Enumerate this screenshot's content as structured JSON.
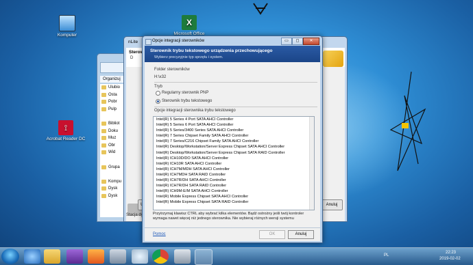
{
  "desktop": {
    "icons": [
      {
        "label": "Komputer",
        "icon": "computer-icon"
      },
      {
        "label": "Microsoft Office",
        "icon": "excel-icon"
      },
      {
        "label": "Acrobat Reader DC",
        "icon": "acrobat-icon"
      }
    ]
  },
  "explorer": {
    "menu": "Organizuj",
    "nav": [
      "Ulubio",
      "Osta",
      "Pobr",
      "Pulp",
      "",
      "Bibliot",
      "Doku",
      "Muz",
      "Obr",
      "Wid",
      "",
      "Grupa",
      "",
      "Kompu",
      "Dysk",
      "Dysk"
    ]
  },
  "nlite": {
    "title": "nLite",
    "head_title": "Sterow",
    "head_sub": "D",
    "status": "Stacja dysk",
    "buttons": [
      "Ul",
      "Anuluj"
    ]
  },
  "dialog": {
    "title": "Opcje integracji sterowników",
    "header_title": "Sterownik trybu tekstowego urządzenia przechowującego",
    "header_subtitle": "Wybierz precyzyjnie typ sprzętu i system.",
    "folder_label": "Folder sterowników",
    "folder_value": "H:\\x32",
    "mode_label": "Tryb",
    "radio_pnp": "Regularny sterownik PNP",
    "radio_text": "Sterownik trybu tekstowego",
    "options_label": "Opcje integracji sterownika trybu tekstowego",
    "drivers": [
      "Intel(R) 5 Series 4 Port SATA AHCI Controller",
      "Intel(R) 5 Series 6 Port SATA AHCI Controller",
      "Intel(R) 5 Series/3400 Series SATA AHCI Controller",
      "Intel(R) 7 Series Chipset Family SATA AHCI Controller",
      "Intel(R) 7 Series/C216 Chipset Family SATA AHCI Controller",
      "Intel(R) Desktop/Workstation/Server Express Chipset SATA AHCI Controller",
      "Intel(R) Desktop/Workstation/Server Express Chipset SATA RAID Controller",
      "Intel(R) ICH10D/DO SATA AHCI Controller",
      "Intel(R) ICH10R SATA AHCI Controller",
      "Intel(R) ICH7M/MDH SATA AHCI Controller",
      "Intel(R) ICH7MDH SATA RAID Controller",
      "Intel(R) ICH7R/DH SATA AHCI Controller",
      "Intel(R) ICH7R/DH SATA RAID Controller",
      "Intel(R) ICH9M-E/M SATA AHCI Controller",
      "Intel(R) Mobile Express Chipset SATA AHCI Controller",
      "Intel(R) Mobile Express Chipset SATA RAID Controller"
    ],
    "note": "Przytrzymaj klawisz CTRL aby wybrać kilka elementów. Bądź ostrożny jeśli twój kontroler wymaga nawet więcej niż jednego sterownika. Nie wybieraj różnych wersji systemu",
    "help_link": "Pomoc",
    "ok_label": "OK",
    "cancel_label": "Anuluj",
    "window_buttons": [
      "▭",
      "◻",
      "✕"
    ]
  },
  "taskbar": {
    "lang": "PL",
    "time": "22:23",
    "date": "2019-02-02"
  }
}
